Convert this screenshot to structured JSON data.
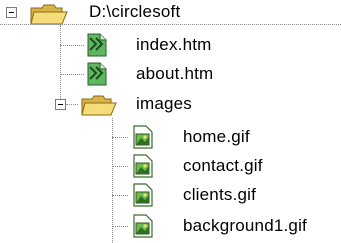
{
  "tree": {
    "root": {
      "label": "D:\\circlesoft",
      "icon": "folder-open-icon",
      "expanded": true
    },
    "files": [
      {
        "label": "index.htm",
        "icon": "html-file-icon"
      },
      {
        "label": "about.htm",
        "icon": "html-file-icon"
      }
    ],
    "subfolder": {
      "label": "images",
      "icon": "folder-open-icon",
      "expanded": true,
      "files": [
        {
          "label": "home.gif",
          "icon": "gif-image-icon"
        },
        {
          "label": "contact.gif",
          "icon": "gif-image-icon"
        },
        {
          "label": "clients.gif",
          "icon": "gif-image-icon"
        },
        {
          "label": "background1.gif",
          "icon": "gif-image-icon"
        }
      ]
    }
  },
  "colors": {
    "folder": "#f3d66a",
    "folder_dark": "#b08d20",
    "html_icon": "#3f9a3f",
    "gif_icon": "#4a8a3c",
    "connector": "#8a8a8a"
  }
}
